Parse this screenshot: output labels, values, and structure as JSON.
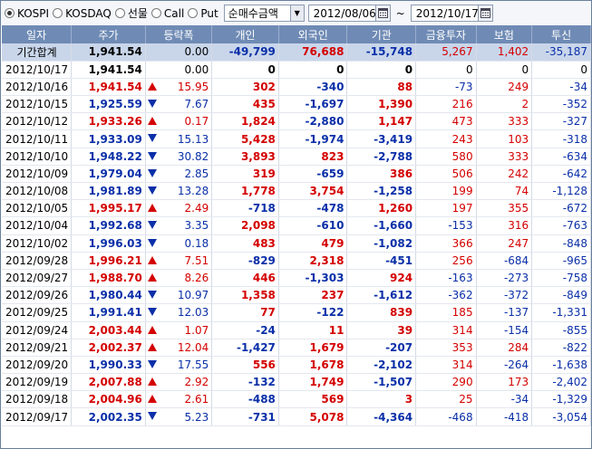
{
  "toolbar": {
    "radios": [
      {
        "label": "KOSPI",
        "selected": true
      },
      {
        "label": "KOSDAQ",
        "selected": false
      },
      {
        "label": "선물",
        "selected": false
      },
      {
        "label": "Call",
        "selected": false
      },
      {
        "label": "Put",
        "selected": false
      }
    ],
    "combo_value": "순매수금액",
    "start_date": "2012/08/06",
    "tilde": "~",
    "end_date": "2012/10/17"
  },
  "columns": [
    "일자",
    "주가",
    "등락폭",
    "개인",
    "외국인",
    "기관",
    "금융투자",
    "보험",
    "투신"
  ],
  "summary": {
    "date": "기간합계",
    "price": "1,941.54",
    "change": "0.00",
    "dir": "none",
    "indiv": "-49,799",
    "foreign": "76,688",
    "inst": "-15,748",
    "fin": "5,267",
    "ins": "1,402",
    "trust": "-35,187"
  },
  "rows": [
    {
      "date": "2012/10/17",
      "price": "1,941.54",
      "change": "0.00",
      "dir": "none",
      "indiv": "0",
      "foreign": "0",
      "inst": "0",
      "fin": "0",
      "ins": "0",
      "trust": "0"
    },
    {
      "date": "2012/10/16",
      "price": "1,941.54",
      "change": "15.95",
      "dir": "up",
      "indiv": "302",
      "foreign": "-340",
      "inst": "88",
      "fin": "-73",
      "ins": "249",
      "trust": "-34"
    },
    {
      "date": "2012/10/15",
      "price": "1,925.59",
      "change": "7.67",
      "dir": "down",
      "indiv": "435",
      "foreign": "-1,697",
      "inst": "1,390",
      "fin": "216",
      "ins": "2",
      "trust": "-352"
    },
    {
      "date": "2012/10/12",
      "price": "1,933.26",
      "change": "0.17",
      "dir": "up",
      "indiv": "1,824",
      "foreign": "-2,880",
      "inst": "1,147",
      "fin": "473",
      "ins": "333",
      "trust": "-327"
    },
    {
      "date": "2012/10/11",
      "price": "1,933.09",
      "change": "15.13",
      "dir": "down",
      "indiv": "5,428",
      "foreign": "-1,974",
      "inst": "-3,419",
      "fin": "243",
      "ins": "103",
      "trust": "-318"
    },
    {
      "date": "2012/10/10",
      "price": "1,948.22",
      "change": "30.82",
      "dir": "down",
      "indiv": "3,893",
      "foreign": "823",
      "inst": "-2,788",
      "fin": "580",
      "ins": "333",
      "trust": "-634"
    },
    {
      "date": "2012/10/09",
      "price": "1,979.04",
      "change": "2.85",
      "dir": "down",
      "indiv": "319",
      "foreign": "-659",
      "inst": "386",
      "fin": "506",
      "ins": "242",
      "trust": "-642"
    },
    {
      "date": "2012/10/08",
      "price": "1,981.89",
      "change": "13.28",
      "dir": "down",
      "indiv": "1,778",
      "foreign": "3,754",
      "inst": "-1,258",
      "fin": "199",
      "ins": "74",
      "trust": "-1,128"
    },
    {
      "date": "2012/10/05",
      "price": "1,995.17",
      "change": "2.49",
      "dir": "up",
      "indiv": "-718",
      "foreign": "-478",
      "inst": "1,260",
      "fin": "197",
      "ins": "355",
      "trust": "-672"
    },
    {
      "date": "2012/10/04",
      "price": "1,992.68",
      "change": "3.35",
      "dir": "down",
      "indiv": "2,098",
      "foreign": "-610",
      "inst": "-1,660",
      "fin": "-153",
      "ins": "316",
      "trust": "-763"
    },
    {
      "date": "2012/10/02",
      "price": "1,996.03",
      "change": "0.18",
      "dir": "down",
      "indiv": "483",
      "foreign": "479",
      "inst": "-1,082",
      "fin": "366",
      "ins": "247",
      "trust": "-848"
    },
    {
      "date": "2012/09/28",
      "price": "1,996.21",
      "change": "7.51",
      "dir": "up",
      "indiv": "-829",
      "foreign": "2,318",
      "inst": "-451",
      "fin": "256",
      "ins": "-684",
      "trust": "-965"
    },
    {
      "date": "2012/09/27",
      "price": "1,988.70",
      "change": "8.26",
      "dir": "up",
      "indiv": "446",
      "foreign": "-1,303",
      "inst": "924",
      "fin": "-163",
      "ins": "-273",
      "trust": "-758"
    },
    {
      "date": "2012/09/26",
      "price": "1,980.44",
      "change": "10.97",
      "dir": "down",
      "indiv": "1,358",
      "foreign": "237",
      "inst": "-1,612",
      "fin": "-362",
      "ins": "-372",
      "trust": "-849"
    },
    {
      "date": "2012/09/25",
      "price": "1,991.41",
      "change": "12.03",
      "dir": "down",
      "indiv": "77",
      "foreign": "-122",
      "inst": "839",
      "fin": "185",
      "ins": "-137",
      "trust": "-1,331"
    },
    {
      "date": "2012/09/24",
      "price": "2,003.44",
      "change": "1.07",
      "dir": "up",
      "indiv": "-24",
      "foreign": "11",
      "inst": "39",
      "fin": "314",
      "ins": "-154",
      "trust": "-855"
    },
    {
      "date": "2012/09/21",
      "price": "2,002.37",
      "change": "12.04",
      "dir": "up",
      "indiv": "-1,427",
      "foreign": "1,679",
      "inst": "-207",
      "fin": "353",
      "ins": "284",
      "trust": "-822"
    },
    {
      "date": "2012/09/20",
      "price": "1,990.33",
      "change": "17.55",
      "dir": "down",
      "indiv": "556",
      "foreign": "1,678",
      "inst": "-2,102",
      "fin": "314",
      "ins": "-264",
      "trust": "-1,638"
    },
    {
      "date": "2012/09/19",
      "price": "2,007.88",
      "change": "2.92",
      "dir": "up",
      "indiv": "-132",
      "foreign": "1,749",
      "inst": "-1,507",
      "fin": "290",
      "ins": "173",
      "trust": "-2,402"
    },
    {
      "date": "2012/09/18",
      "price": "2,004.96",
      "change": "2.61",
      "dir": "up",
      "indiv": "-488",
      "foreign": "569",
      "inst": "3",
      "fin": "25",
      "ins": "-34",
      "trust": "-1,329"
    },
    {
      "date": "2012/09/17",
      "price": "2,002.35",
      "change": "5.23",
      "dir": "down",
      "indiv": "-731",
      "foreign": "5,078",
      "inst": "-4,364",
      "fin": "-468",
      "ins": "-418",
      "trust": "-3,054"
    }
  ],
  "colors": {
    "header_bg": "#6f8bb5",
    "summary_bg": "#c9d6ea",
    "up": "#d40000",
    "down": "#0a2fa8"
  }
}
